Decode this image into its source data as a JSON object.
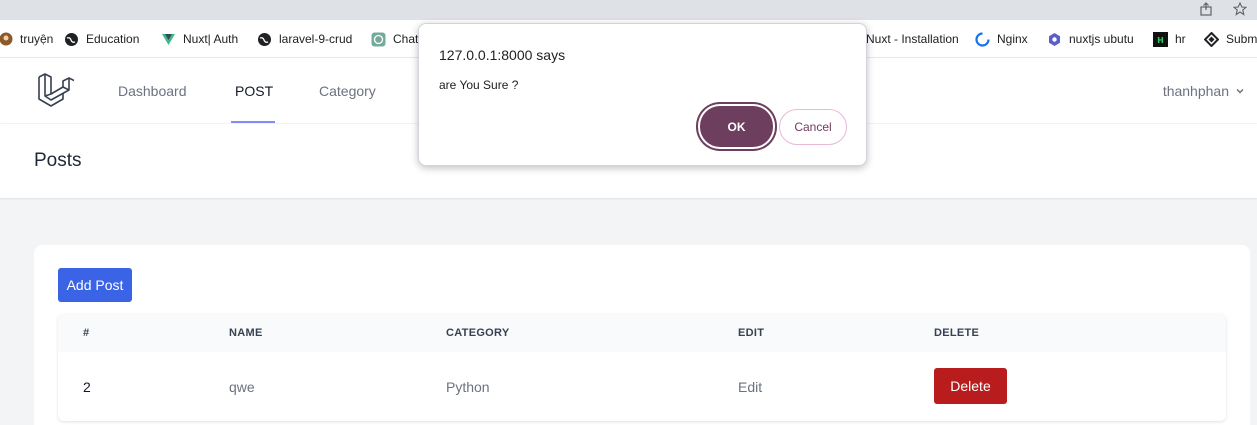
{
  "bookmarks": [
    {
      "label": "truyện",
      "icon": "user-avatar-icon"
    },
    {
      "label": "Education",
      "icon": "globe-icon"
    },
    {
      "label": "Nuxt| Auth",
      "icon": "vue-logo-icon"
    },
    {
      "label": "laravel-9-crud",
      "icon": "globe-icon"
    },
    {
      "label": "Chat",
      "icon": "openai-icon"
    },
    {
      "label": "Nuxt - Installation",
      "icon": "nuxt-icon"
    },
    {
      "label": "Nginx",
      "icon": "nginx-icon"
    },
    {
      "label": "nuxtjs ubutu",
      "icon": "hexagon-icon"
    },
    {
      "label": "hr",
      "icon": "hr-icon"
    },
    {
      "label": "Subm",
      "icon": "diamond-icon"
    }
  ],
  "nav": {
    "links": [
      "Dashboard",
      "POST",
      "Category"
    ],
    "active_index": 1,
    "user": "thanhphan"
  },
  "page": {
    "title": "Posts",
    "add_button": "Add Post"
  },
  "table": {
    "headers": [
      "#",
      "NAME",
      "CATEGORY",
      "EDIT",
      "DELETE"
    ],
    "rows": [
      {
        "id": "2",
        "name": "qwe",
        "category": "Python",
        "edit": "Edit",
        "delete": "Delete"
      }
    ]
  },
  "dialog": {
    "title": "127.0.0.1:8000 says",
    "message": "are You Sure ?",
    "ok": "OK",
    "cancel": "Cancel"
  },
  "colors": {
    "primary": "#3b63e6",
    "danger": "#b91c1c",
    "dialog_accent": "#6e3e5e",
    "nav_underline": "#818cf8"
  }
}
